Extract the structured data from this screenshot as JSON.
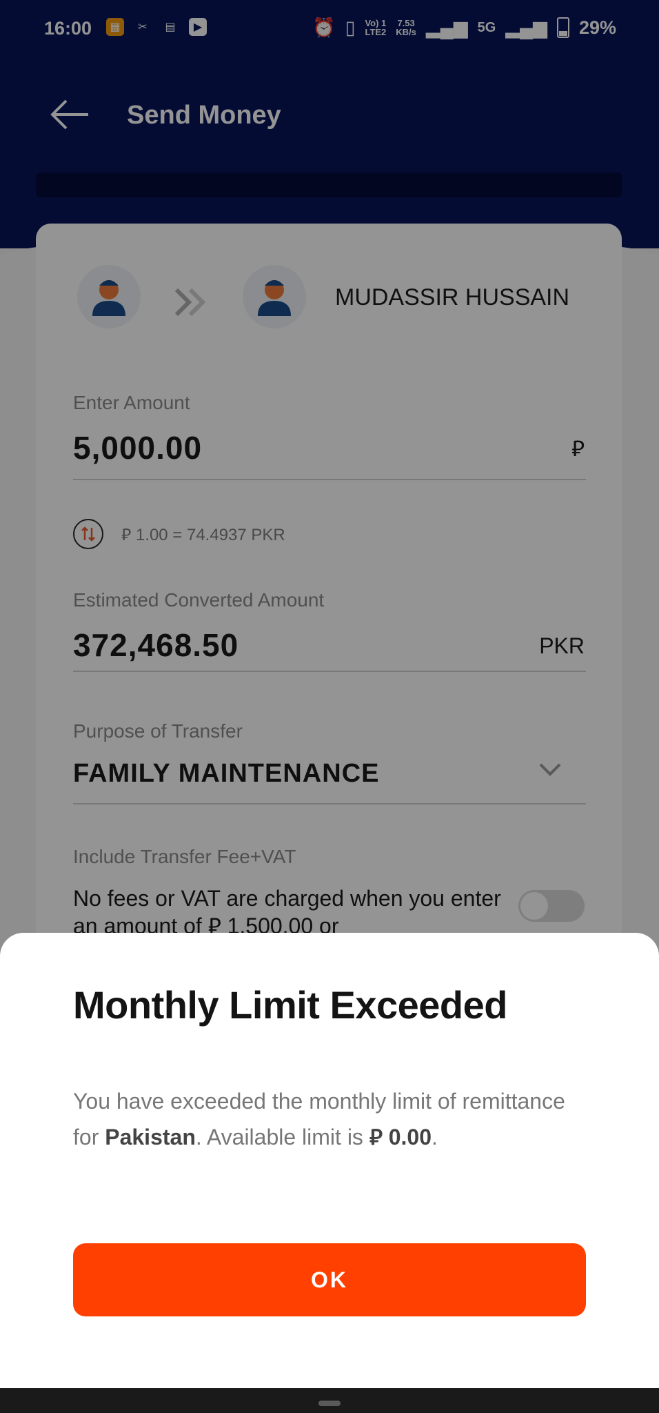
{
  "status_bar": {
    "time": "16:00",
    "net_speed_value": "7.53",
    "net_speed_unit": "KB/s",
    "volte_line1": "Vo) 1",
    "volte_line2": "LTE2",
    "network": "5G",
    "battery": "29%"
  },
  "header": {
    "title": "Send Money"
  },
  "transfer": {
    "receiver_name": "MUDASSIR HUSSAIN",
    "amount_label": "Enter Amount",
    "amount_value": "5,000.00",
    "amount_currency_symbol": "⃁",
    "rate_text": "⃁ 1.00 = 74.4937 PKR",
    "converted_label": "Estimated Converted Amount",
    "converted_value": "372,468.50",
    "converted_currency": "PKR",
    "purpose_label": "Purpose of Transfer",
    "purpose_value": "FAMILY MAINTENANCE",
    "fee_label": "Include Transfer Fee+VAT",
    "fee_text": "No fees or VAT are charged when you enter an amount of ⃁ 1,500.00 or",
    "fee_toggle_on": false
  },
  "dialog": {
    "title": "Monthly Limit Exceeded",
    "message_part1": "You have exceeded the monthly limit of remittance for ",
    "message_country": "Pakistan",
    "message_part2": ". Available limit is ",
    "message_limit": "⃁ 0.00",
    "message_end": ".",
    "ok_label": "OK"
  },
  "colors": {
    "header_navy": "#07155a",
    "accent_orange": "#ff4000"
  }
}
